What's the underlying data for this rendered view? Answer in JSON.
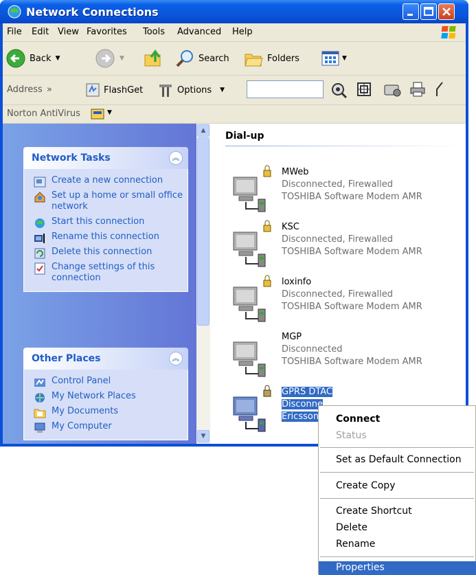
{
  "window": {
    "title": "Network Connections"
  },
  "menu": [
    "File",
    "Edit",
    "View",
    "Favorites",
    "Tools",
    "Advanced",
    "Help"
  ],
  "toolbar": {
    "back": "Back",
    "search": "Search",
    "folders": "Folders"
  },
  "address": {
    "label": "Address",
    "flashget": "FlashGet",
    "options": "Options",
    "value": ""
  },
  "norton": {
    "label": "Norton AntiVirus"
  },
  "network_tasks": {
    "title": "Network Tasks",
    "items": [
      "Create a new connection",
      "Set up a home or small office network",
      "Start this connection",
      "Rename this connection",
      "Delete this connection",
      "Change settings of this connection"
    ]
  },
  "other_places": {
    "title": "Other Places",
    "items": [
      "Control Panel",
      "My Network Places",
      "My Documents",
      "My Computer"
    ]
  },
  "group": {
    "title": "Dial-up"
  },
  "connections": [
    {
      "name": "MWeb",
      "status": "Disconnected, Firewalled",
      "device": "TOSHIBA Software Modem AMR"
    },
    {
      "name": "KSC",
      "status": "Disconnected, Firewalled",
      "device": "TOSHIBA Software Modem AMR"
    },
    {
      "name": "loxinfo",
      "status": "Disconnected, Firewalled",
      "device": "TOSHIBA Software Modem AMR"
    },
    {
      "name": "MGP",
      "status": "Disconnected",
      "device": "TOSHIBA Software Modem AMR"
    },
    {
      "name": "GPRS DTAC",
      "status": "Disconne",
      "device": "Ericsson"
    }
  ],
  "context_menu": {
    "connect": "Connect",
    "status": "Status",
    "set_default": "Set as Default Connection",
    "create_copy": "Create Copy",
    "create_shortcut": "Create Shortcut",
    "delete": "Delete",
    "rename": "Rename",
    "properties": "Properties"
  }
}
